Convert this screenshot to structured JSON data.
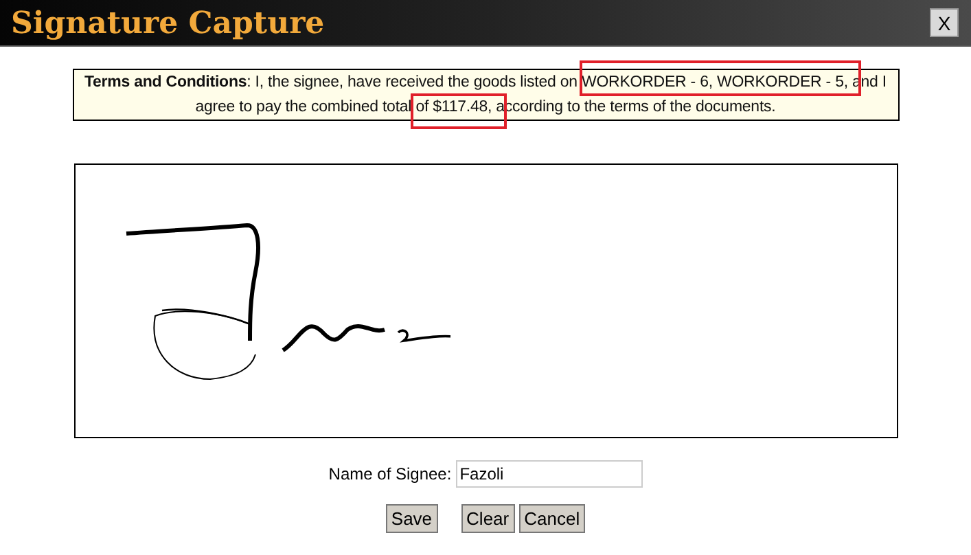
{
  "window": {
    "title": "Signature Capture",
    "close": "X"
  },
  "terms": "**Terms and Conditions**: I, the signee, have received the goods listed on WORKORDER - 6, WORKORDER - 5, and I agree to pay the combined total of $117.48, according to the terms of the documents.",
  "signee": {
    "label": "Name of Signee:",
    "value": "Fazoli"
  },
  "buttons": [
    "Save",
    "Clear",
    "Cancel"
  ]
}
